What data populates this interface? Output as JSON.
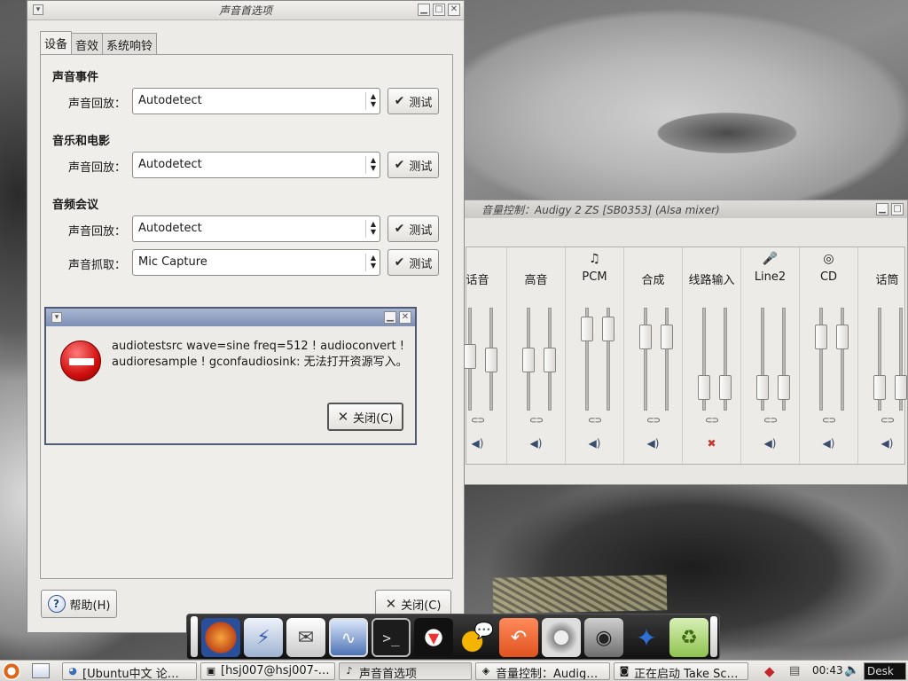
{
  "prefs": {
    "title": "声音首选项",
    "tabs": [
      "设备",
      "音效",
      "系统响铃"
    ],
    "sections": [
      {
        "heading": "声音事件",
        "rows": [
          {
            "label": "声音回放：",
            "value": "Autodetect",
            "test": "测试"
          }
        ]
      },
      {
        "heading": "音乐和电影",
        "rows": [
          {
            "label": "声音回放：",
            "value": "Autodetect",
            "test": "测试"
          }
        ]
      },
      {
        "heading": "音频会议",
        "rows": [
          {
            "label": "声音回放：",
            "value": "Autodetect",
            "test": "测试"
          },
          {
            "label": "声音抓取：",
            "value": "Mic Capture",
            "test": "测试"
          }
        ]
      }
    ],
    "help_label": "帮助(H)",
    "close_label": "关闭(C)"
  },
  "mixer": {
    "title": "音量控制：Audigy 2 ZS [SB0353] (Alsa mixer)",
    "channels": [
      {
        "label": "话音",
        "icon": "",
        "left": 0.55,
        "right": 0.5,
        "muted": false
      },
      {
        "label": "高音",
        "icon": "",
        "left": 0.5,
        "right": 0.5,
        "muted": false
      },
      {
        "label": "PCM",
        "icon": "♫",
        "left": 0.9,
        "right": 0.9,
        "muted": false
      },
      {
        "label": "合成",
        "icon": "",
        "left": 0.8,
        "right": 0.8,
        "muted": false
      },
      {
        "label": "线路输入",
        "icon": "",
        "left": 0.15,
        "right": 0.15,
        "muted": true
      },
      {
        "label": "Line2",
        "icon": "🎤",
        "left": 0.15,
        "right": 0.15,
        "muted": false
      },
      {
        "label": "CD",
        "icon": "◎",
        "left": 0.8,
        "right": 0.8,
        "muted": false
      },
      {
        "label": "话筒",
        "icon": "",
        "left": 0.15,
        "right": 0.15,
        "muted": false
      }
    ]
  },
  "dialog": {
    "message": "audiotestsrc wave=sine freq=512 ! audioconvert ! audioresample ! gconfaudiosink: 无法打开资源写入。",
    "close_label": "关闭(C)"
  },
  "taskbar": {
    "tasks": [
      "[Ubuntu中文 论…",
      "[hsj007@hsj007-…",
      "声音首选项",
      "音量控制：Audig…",
      "正在启动 Take Sc…"
    ],
    "clock": "00:43",
    "desk_label": "Desk"
  }
}
